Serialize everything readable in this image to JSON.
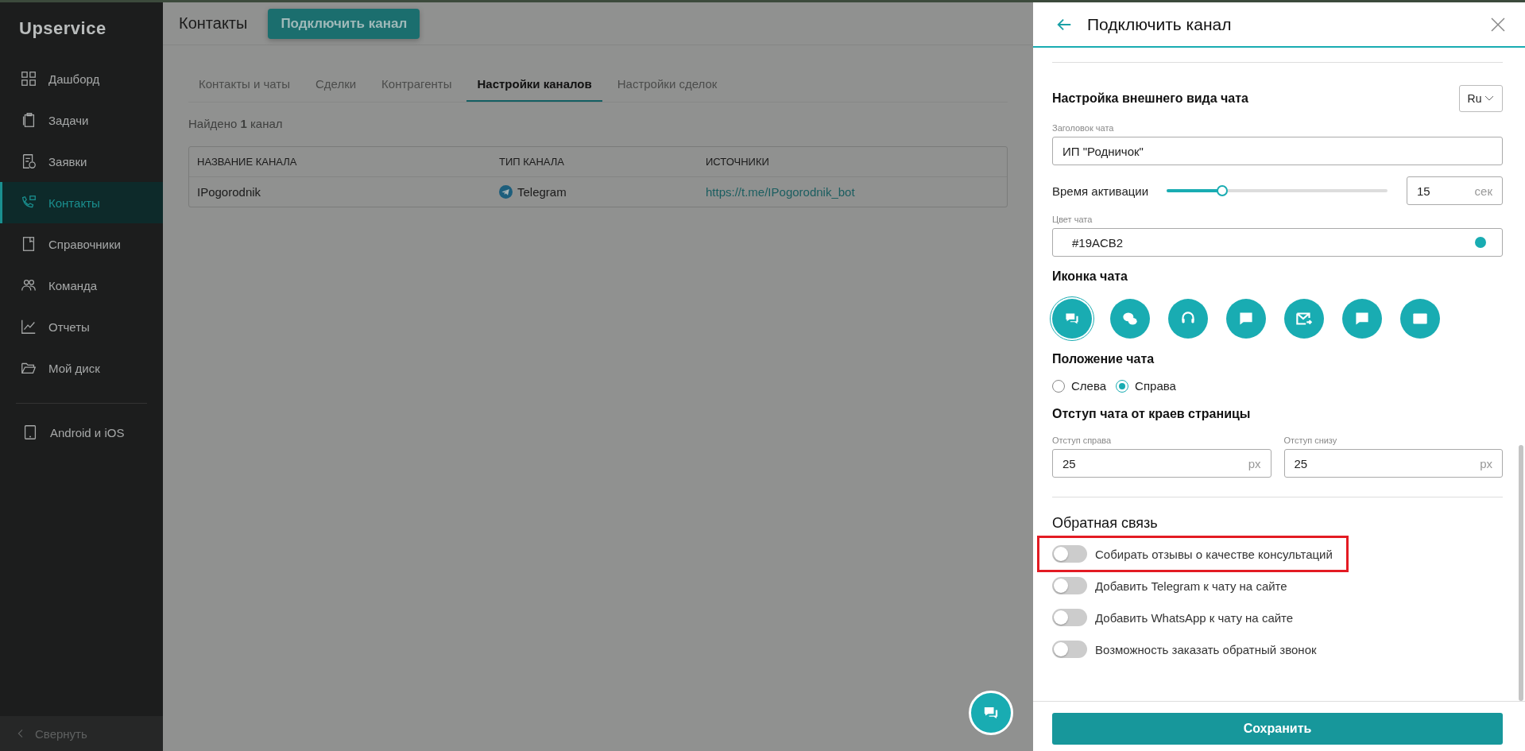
{
  "sidebar": {
    "logo": "Upservice",
    "items": [
      {
        "label": "Дашборд",
        "selected": false
      },
      {
        "label": "Задачи",
        "selected": false
      },
      {
        "label": "Заявки",
        "selected": false
      },
      {
        "label": "Контакты",
        "selected": true
      },
      {
        "label": "Справочники",
        "selected": false
      },
      {
        "label": "Команда",
        "selected": false
      },
      {
        "label": "Отчеты",
        "selected": false
      },
      {
        "label": "Мой диск",
        "selected": false
      }
    ],
    "apps": "Android и iOS",
    "collapse": "Свернуть"
  },
  "header": {
    "title": "Контакты",
    "button": "Подключить канал"
  },
  "tabs": [
    {
      "label": "Контакты и чаты",
      "selected": false
    },
    {
      "label": "Сделки",
      "selected": false
    },
    {
      "label": "Контрагенты",
      "selected": false
    },
    {
      "label": "Настройки каналов",
      "selected": true
    },
    {
      "label": "Настройки сделок",
      "selected": false
    }
  ],
  "found": "Найдено **1** канал",
  "table": {
    "columns": [
      "НАЗВАНИЕ КАНАЛА",
      "ТИП КАНАЛА",
      "ИСТОЧНИКИ"
    ],
    "rows": [
      {
        "name": "IPogorodnik",
        "type": "Telegram",
        "source": "https://t.me/IPogorodnik_bot"
      }
    ]
  },
  "panel": {
    "title": "Подключить канал",
    "section_title": "Настройка внешнего вида чата",
    "language": "Ru",
    "chat_title": {
      "label": "Заголовок чата",
      "value": "ИП \"Родничок\""
    },
    "activation": {
      "label": "Время активации",
      "level": 0.25,
      "value": "15",
      "unit": "сек"
    },
    "chat_color": {
      "label": "Цвет чата",
      "value": "#19ACB2",
      "color": "#19acb2"
    },
    "icon_label": "Иконка чата",
    "icon_options": [
      {
        "selected": true
      },
      {
        "selected": false
      },
      {
        "selected": false
      },
      {
        "selected": false
      },
      {
        "selected": false
      },
      {
        "selected": false
      },
      {
        "selected": false
      }
    ],
    "position_label": "Положение чата",
    "positions": [
      {
        "label": "Слева",
        "selected": false
      },
      {
        "label": "Справа",
        "selected": true
      }
    ],
    "offset_title": "Отступ чата от краев страницы",
    "offsets": [
      {
        "label": "Отступ справа",
        "value": "25",
        "unit": "px"
      },
      {
        "label": "Отступ снизу",
        "value": "25",
        "unit": "px"
      }
    ],
    "feedback_title": "Обратная связь",
    "toggles": [
      {
        "label": "Собирать отзывы о качестве консультаций",
        "on": false,
        "highlighted": true
      },
      {
        "label": "Добавить Telegram к чату на сайте",
        "on": false,
        "highlighted": false
      },
      {
        "label": "Добавить WhatsApp к чату на сайте",
        "on": false,
        "highlighted": false
      },
      {
        "label": "Возможность заказать обратный звонок",
        "on": false,
        "highlighted": false
      }
    ],
    "save": "Сохранить"
  }
}
